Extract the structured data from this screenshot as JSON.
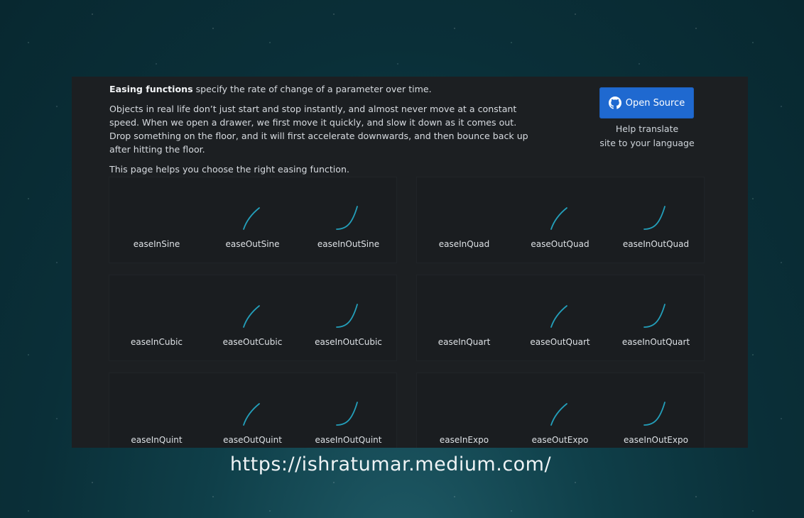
{
  "intro": {
    "title_bold": "Easing functions",
    "title_rest": "specify the rate of change of a parameter over time.",
    "paragraph2": "Objects in real life don’t just start and stop instantly, and almost never move at a constant speed. When we open a drawer, we first move it quickly, and slow it down as it comes out. Drop something on the floor, and it will first accelerate downwards, and then bounce back up after hitting the floor.",
    "paragraph3": "This page helps you choose the right easing function."
  },
  "github_button": {
    "label": "Open Source",
    "icon": "github-icon"
  },
  "help_text": {
    "line1": "Help translate",
    "line2": "site to your language"
  },
  "curve_color": "#26b6d6",
  "groups": [
    {
      "items": [
        {
          "label": "easeInSine"
        },
        {
          "label": "easeOutSine"
        },
        {
          "label": "easeInOutSine"
        }
      ]
    },
    {
      "items": [
        {
          "label": "easeInQuad"
        },
        {
          "label": "easeOutQuad"
        },
        {
          "label": "easeInOutQuad"
        }
      ]
    },
    {
      "items": [
        {
          "label": "easeInCubic"
        },
        {
          "label": "easeOutCubic"
        },
        {
          "label": "easeInOutCubic"
        }
      ]
    },
    {
      "items": [
        {
          "label": "easeInQuart"
        },
        {
          "label": "easeOutQuart"
        },
        {
          "label": "easeInOutQuart"
        }
      ]
    },
    {
      "items": [
        {
          "label": "easeInQuint"
        },
        {
          "label": "easeOutQuint"
        },
        {
          "label": "easeInOutQuint"
        }
      ]
    },
    {
      "items": [
        {
          "label": "easeInExpo"
        },
        {
          "label": "easeOutExpo"
        },
        {
          "label": "easeInOutExpo"
        }
      ]
    }
  ],
  "footer_url": "https://ishratumar.medium.com/"
}
